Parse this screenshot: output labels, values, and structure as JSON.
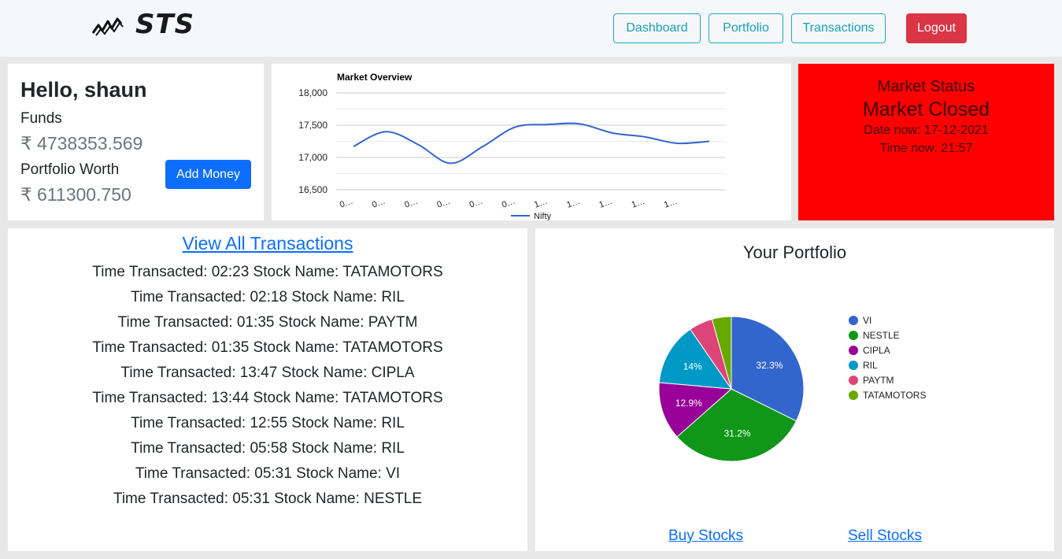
{
  "header": {
    "brand": "STS",
    "nav": [
      {
        "label": "Dashboard"
      },
      {
        "label": "Portfolio"
      },
      {
        "label": "Transactions"
      }
    ],
    "logout_label": "Logout"
  },
  "greeting": {
    "hello": "Hello, shaun",
    "funds_label": "Funds",
    "funds_value": "₹ 4738353.569",
    "worth_label": "Portfolio Worth",
    "worth_value": "₹ 611300.750",
    "add_money_label": "Add Money"
  },
  "market_status": {
    "title": "Market Status",
    "state": "Market Closed",
    "date": "Date now: 17-12-2021",
    "time": "Time now: 21:57",
    "bg_color": "#ff0000"
  },
  "transactions": {
    "view_all_label": "View All Transactions",
    "items": [
      "Time Transacted: 02:23 Stock Name: TATAMOTORS",
      "Time Transacted: 02:18 Stock Name: RIL",
      "Time Transacted: 01:35 Stock Name: PAYTM",
      "Time Transacted: 01:35 Stock Name: TATAMOTORS",
      "Time Transacted: 13:47 Stock Name: CIPLA",
      "Time Transacted: 13:44 Stock Name: TATAMOTORS",
      "Time Transacted: 12:55 Stock Name: RIL",
      "Time Transacted: 05:58 Stock Name: RIL",
      "Time Transacted: 05:31 Stock Name: VI",
      "Time Transacted: 05:31 Stock Name: NESTLE"
    ]
  },
  "portfolio": {
    "title": "Your Portfolio",
    "buy_label": "Buy Stocks",
    "sell_label": "Sell Stocks"
  },
  "chart_data": [
    {
      "type": "line",
      "title": "Market Overview",
      "x": [
        "0…",
        "0…",
        "0…",
        "0…",
        "0…",
        "0…",
        "1…",
        "1…",
        "1…",
        "1…",
        "1…"
      ],
      "series": [
        {
          "name": "Nifty",
          "color": "#3366cc",
          "values": [
            17170,
            17400,
            17200,
            16910,
            17170,
            17470,
            17510,
            17520,
            17380,
            17320,
            17220,
            17250
          ]
        }
      ],
      "ylim": [
        16500,
        18000
      ],
      "yticks": [
        "16,500",
        "17,000",
        "17,500",
        "18,000"
      ],
      "grid": true,
      "legend": "bottom"
    },
    {
      "type": "pie",
      "slices": [
        {
          "label": "VI",
          "value": 32.3,
          "color": "#3366cc",
          "show_label": "32.3%"
        },
        {
          "label": "NESTLE",
          "value": 31.2,
          "color": "#109618",
          "show_label": "31.2%"
        },
        {
          "label": "CIPLA",
          "value": 12.9,
          "color": "#990099",
          "show_label": "12.9%"
        },
        {
          "label": "RIL",
          "value": 14.0,
          "color": "#0099c6",
          "show_label": "14%"
        },
        {
          "label": "PAYTM",
          "value": 5.3,
          "color": "#dd4477",
          "show_label": ""
        },
        {
          "label": "TATAMOTORS",
          "value": 4.3,
          "color": "#66aa00",
          "show_label": ""
        }
      ],
      "legend": "right"
    }
  ]
}
